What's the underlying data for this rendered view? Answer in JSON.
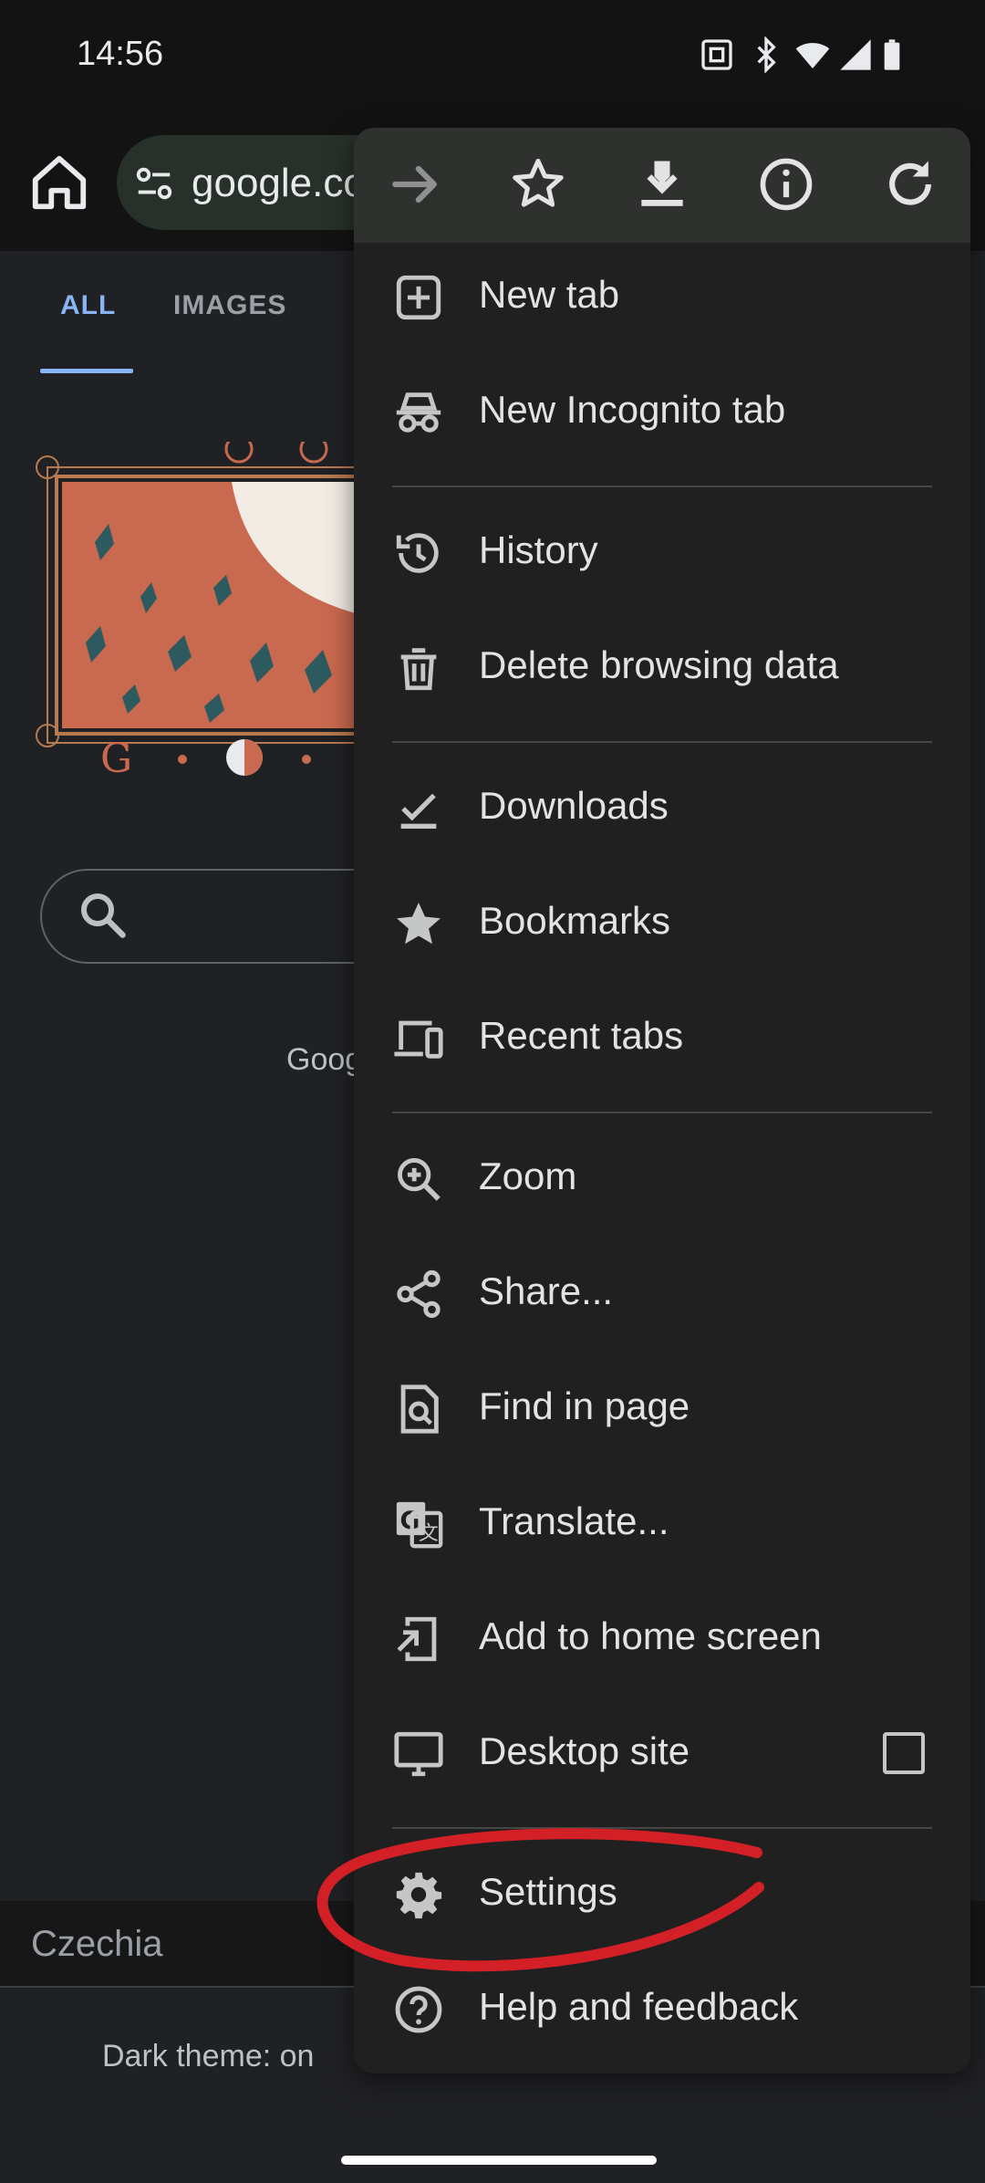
{
  "status_bar": {
    "time": "14:56"
  },
  "toolbar": {
    "url_text": "google.co"
  },
  "page": {
    "tabs": [
      {
        "label": "ALL"
      },
      {
        "label": "IMAGES"
      }
    ],
    "doodle_text": "G • ◐ • ",
    "partial_text": "Goog",
    "country": "Czechia",
    "dark_theme": "Dark theme: on"
  },
  "menu": {
    "top_icons": [
      "forward-icon",
      "bookmark-star-icon",
      "download-icon",
      "info-icon",
      "reload-icon"
    ],
    "items": [
      {
        "label": "New tab",
        "icon": "new-tab-icon"
      },
      {
        "label": "New Incognito tab",
        "icon": "incognito-icon"
      },
      {
        "label": "History",
        "icon": "history-icon"
      },
      {
        "label": "Delete browsing data",
        "icon": "trash-icon"
      },
      {
        "label": "Downloads",
        "icon": "downloads-check-icon"
      },
      {
        "label": "Bookmarks",
        "icon": "star-icon"
      },
      {
        "label": "Recent tabs",
        "icon": "devices-icon"
      },
      {
        "label": "Zoom",
        "icon": "zoom-icon"
      },
      {
        "label": "Share...",
        "icon": "share-icon"
      },
      {
        "label": "Find in page",
        "icon": "find-in-page-icon"
      },
      {
        "label": "Translate...",
        "icon": "translate-icon"
      },
      {
        "label": "Add to home screen",
        "icon": "add-to-home-icon"
      },
      {
        "label": "Desktop site",
        "icon": "desktop-icon"
      },
      {
        "label": "Settings",
        "icon": "gear-icon"
      },
      {
        "label": "Help and feedback",
        "icon": "help-icon"
      }
    ]
  },
  "colors": {
    "accent": "#8ab4f8",
    "annotation": "#d31f26",
    "menu_bg": "#1f201f"
  }
}
